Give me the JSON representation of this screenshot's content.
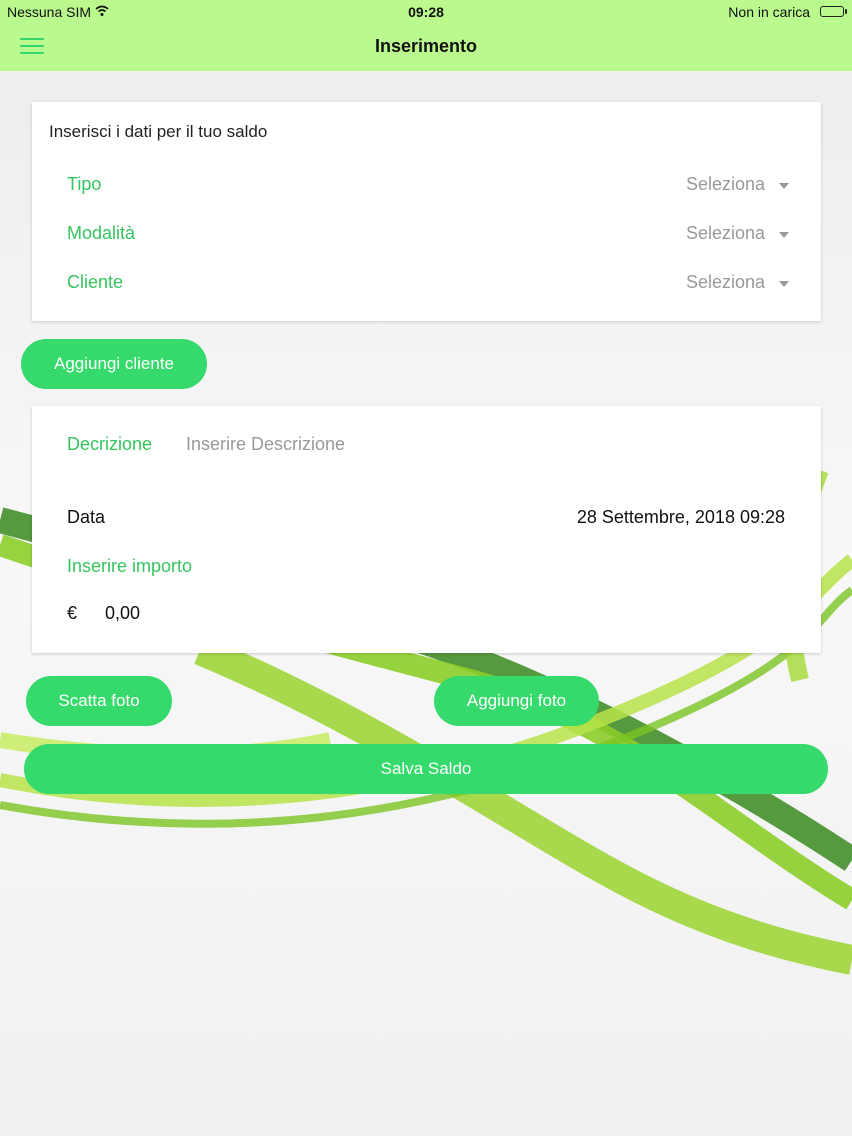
{
  "status_bar": {
    "carrier": "Nessuna SIM",
    "time": "09:28",
    "charging": "Non in carica"
  },
  "header": {
    "title": "Inserimento",
    "menu_icon": "hamburger-icon"
  },
  "form": {
    "heading": "Inserisci i dati per il tuo saldo",
    "fields": [
      {
        "label": "Tipo",
        "value": "Seleziona"
      },
      {
        "label": "Modalità",
        "value": "Seleziona"
      },
      {
        "label": "Cliente",
        "value": "Seleziona"
      }
    ]
  },
  "add_client_button": "Aggiungi cliente",
  "details": {
    "description_label": "Decrizione",
    "description_placeholder": "Inserire Descrizione",
    "date_label": "Data",
    "date_value": "28 Settembre, 2018 09:28",
    "amount_label": "Inserire importo",
    "currency": "€",
    "amount_value": "0,00"
  },
  "buttons": {
    "take_photo": "Scatta foto",
    "add_photo": "Aggiungi foto",
    "save": "Salva Saldo"
  },
  "colors": {
    "header_bg": "#b9f98d",
    "accent": "#36d96b",
    "label_green": "#36c45e"
  }
}
